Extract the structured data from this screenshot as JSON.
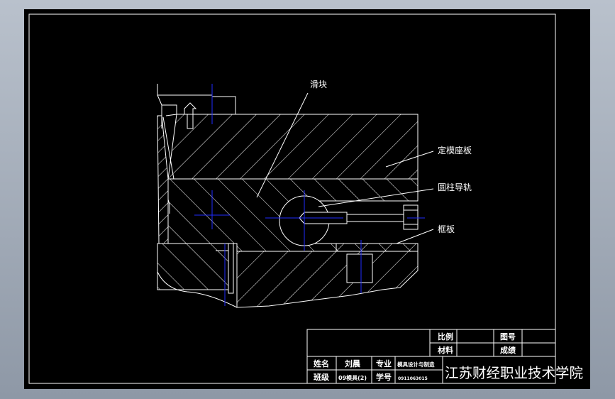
{
  "drawing": {
    "callouts": {
      "slider": "滑块",
      "fixed_plate": "定模座板",
      "guide_rail": "圆柱导轨",
      "frame_plate": "框板"
    }
  },
  "title_block": {
    "scale_label": "比例",
    "material_label": "材料",
    "drawing_no_label": "图号",
    "grade_label": "成绩",
    "name_label": "姓名",
    "name_value": "刘晨",
    "major_label": "专业",
    "major_value": "模具设计与制造",
    "class_label": "班级",
    "class_value": "09模具(2)",
    "student_no_label": "学号",
    "student_no_value": "0911063015",
    "school": "江苏财经职业技术学院"
  },
  "colors": {
    "background": "#000000",
    "lines": "#ffffff",
    "centerlines": "#1f2bff",
    "canvas_frame": "#b9c1cc"
  }
}
